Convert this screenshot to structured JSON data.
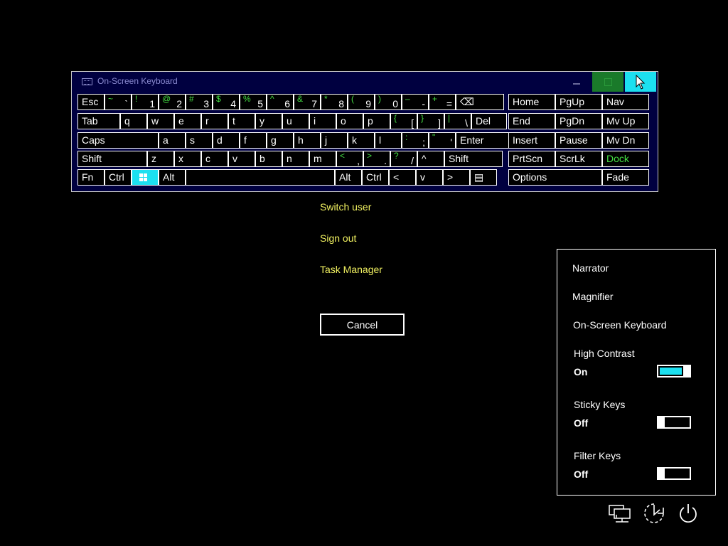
{
  "osk": {
    "title": "On-Screen Keyboard",
    "rows": [
      [
        {
          "main": "Esc"
        },
        {
          "up": "~",
          "low": "`"
        },
        {
          "up": "!",
          "low": "1"
        },
        {
          "up": "@",
          "low": "2"
        },
        {
          "up": "#",
          "low": "3"
        },
        {
          "up": "$",
          "low": "4"
        },
        {
          "up": "%",
          "low": "5"
        },
        {
          "up": "^",
          "low": "6"
        },
        {
          "up": "&",
          "low": "7"
        },
        {
          "up": "*",
          "low": "8"
        },
        {
          "up": "(",
          "low": "9"
        },
        {
          "up": ")",
          "low": "0"
        },
        {
          "up": "–",
          "low": "-"
        },
        {
          "up": "+",
          "low": "="
        },
        {
          "main": "⌫"
        },
        {
          "main": "Home"
        },
        {
          "main": "PgUp"
        },
        {
          "main": "Nav"
        }
      ],
      [
        {
          "main": "Tab"
        },
        {
          "main": "q"
        },
        {
          "main": "w"
        },
        {
          "main": "e"
        },
        {
          "main": "r"
        },
        {
          "main": "t"
        },
        {
          "main": "y"
        },
        {
          "main": "u"
        },
        {
          "main": "i"
        },
        {
          "main": "o"
        },
        {
          "main": "p"
        },
        {
          "up": "{",
          "low": "["
        },
        {
          "up": "}",
          "low": "]"
        },
        {
          "up": "|",
          "low": "\\"
        },
        {
          "main": "Del"
        },
        {
          "main": "End"
        },
        {
          "main": "PgDn"
        },
        {
          "main": "Mv Up"
        }
      ],
      [
        {
          "main": "Caps"
        },
        {
          "main": "a"
        },
        {
          "main": "s"
        },
        {
          "main": "d"
        },
        {
          "main": "f"
        },
        {
          "main": "g"
        },
        {
          "main": "h"
        },
        {
          "main": "j"
        },
        {
          "main": "k"
        },
        {
          "main": "l"
        },
        {
          "up": ":",
          "low": ";"
        },
        {
          "up": "\"",
          "low": "'"
        },
        {
          "main": "Enter"
        },
        {
          "main": "Insert"
        },
        {
          "main": "Pause"
        },
        {
          "main": "Mv Dn"
        }
      ],
      [
        {
          "main": "Shift"
        },
        {
          "main": "z"
        },
        {
          "main": "x"
        },
        {
          "main": "c"
        },
        {
          "main": "v"
        },
        {
          "main": "b"
        },
        {
          "main": "n"
        },
        {
          "main": "m"
        },
        {
          "up": "<",
          "low": ","
        },
        {
          "up": ">",
          "low": "."
        },
        {
          "up": "?",
          "low": "/"
        },
        {
          "main": "^"
        },
        {
          "main": "Shift"
        },
        {
          "main": "PrtScn"
        },
        {
          "main": "ScrLk"
        },
        {
          "main": "Dock",
          "green": true
        }
      ],
      [
        {
          "main": "Fn"
        },
        {
          "main": "Ctrl"
        },
        {
          "main": "",
          "win": true
        },
        {
          "main": "Alt"
        },
        {
          "main": ""
        },
        {
          "main": "Alt"
        },
        {
          "main": "Ctrl"
        },
        {
          "main": "<"
        },
        {
          "main": "v"
        },
        {
          "main": ">"
        },
        {
          "main": "▤"
        },
        {
          "main": "Options"
        },
        {
          "main": "Fade"
        }
      ]
    ]
  },
  "options": {
    "switch_user": "Switch user",
    "sign_out": "Sign out",
    "task_manager": "Task Manager",
    "cancel": "Cancel"
  },
  "ease": {
    "narrator": "Narrator",
    "magnifier": "Magnifier",
    "osk": "On-Screen Keyboard",
    "high_contrast": {
      "label": "High Contrast",
      "state": "On"
    },
    "sticky_keys": {
      "label": "Sticky Keys",
      "state": "Off"
    },
    "filter_keys": {
      "label": "Filter Keys",
      "state": "Off"
    }
  },
  "colors": {
    "accent": "#1ce0f0",
    "link": "#f0f060",
    "keyboard_alt": "#44e044"
  },
  "icons": [
    "network-icon",
    "ease-of-access-icon",
    "power-icon"
  ]
}
